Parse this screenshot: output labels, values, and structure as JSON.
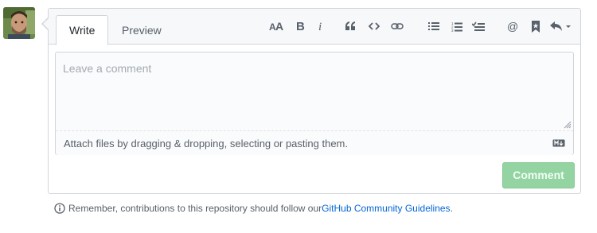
{
  "tabs": [
    {
      "label": "Write",
      "selected": true
    },
    {
      "label": "Preview",
      "selected": false
    }
  ],
  "toolbar": {
    "icons": [
      "text-size-icon",
      "bold-icon",
      "italic-icon",
      "quote-icon",
      "code-icon",
      "link-icon",
      "unordered-list-icon",
      "ordered-list-icon",
      "task-list-icon",
      "mention-icon",
      "reference-icon",
      "reply-icon"
    ]
  },
  "editor": {
    "placeholder": "Leave a comment",
    "value": "",
    "attach_text": "Attach files by dragging & dropping, selecting or pasting them."
  },
  "submit": {
    "label": "Comment",
    "enabled": false,
    "color": "#94d3a2"
  },
  "notice": {
    "prefix": "Remember, contributions to this repository should follow our ",
    "link": "GitHub Community Guidelines",
    "suffix": "."
  },
  "colors": {
    "link": "#0366d6",
    "border": "#d1d5da",
    "tabbar_bg": "#f6f8fa"
  }
}
